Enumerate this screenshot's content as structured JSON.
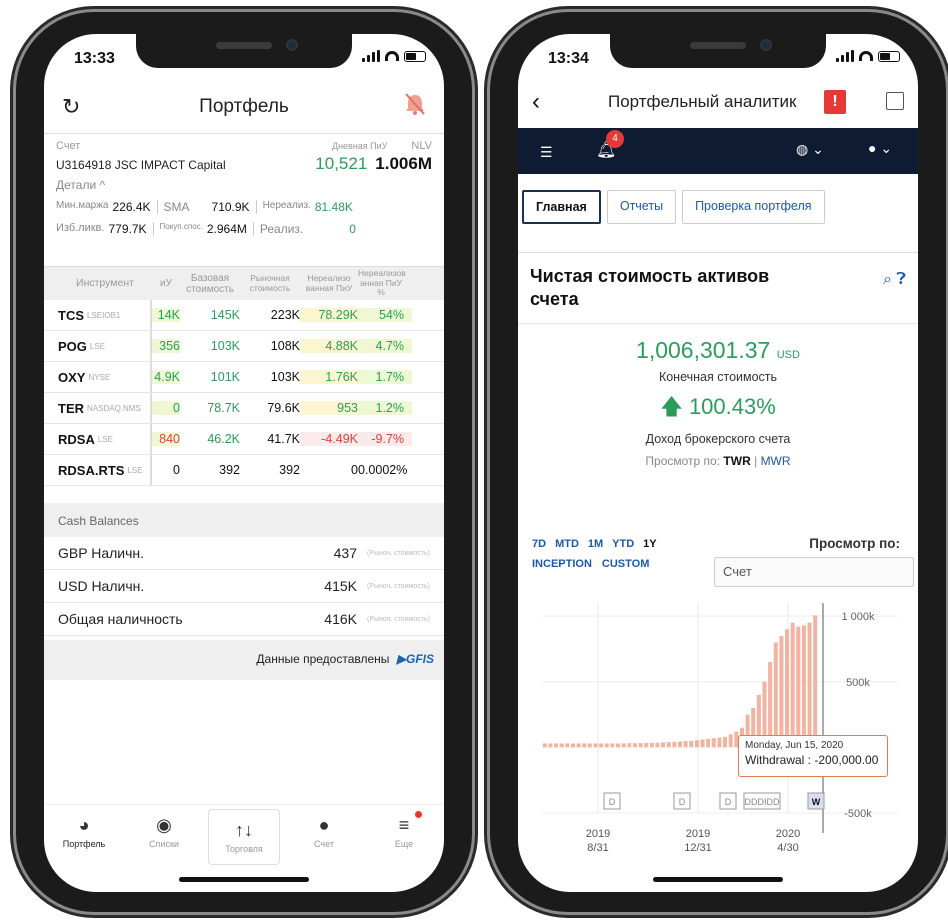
{
  "left": {
    "status_time": "13:33",
    "title": "Портфель",
    "account": {
      "label": "Счет",
      "daily_pnl_label": "Дневная ПиУ",
      "nlv_label": "NLV",
      "name": "U3164918 JSC IMPACT Capital",
      "daily_pnl": "10,521",
      "nlv": "1.006M",
      "details": "Детали ^"
    },
    "metrics": [
      {
        "l1": "Мин.маржа",
        "v1": "226.4K",
        "l2": "SMA",
        "v2": "710.9K",
        "l3": "Нереализ.",
        "v3": "81.48K"
      },
      {
        "l1": "Изб.ликв.",
        "v1": "779.7K",
        "l2": "Покуп.спос.",
        "v2": "2.964M",
        "l3": "Реализ.",
        "v3": "0"
      }
    ],
    "table_headers": [
      "Инструмент",
      "иУ",
      "Базовая стоимость",
      "Рыночная стоимость",
      "Нереализо ванная ПиУ",
      "Нереализов анная ПиУ %"
    ],
    "rows": [
      {
        "sym": "TCS",
        "ex": "LSEIOB1",
        "c1": "14K",
        "c2": "145K",
        "c3": "223K",
        "c4": "78.29K",
        "c5": "54%",
        "tone": "pos"
      },
      {
        "sym": "POG",
        "ex": "LSE",
        "c1": "356",
        "c2": "103K",
        "c3": "108K",
        "c4": "4.88K",
        "c5": "4.7%",
        "tone": "pos"
      },
      {
        "sym": "OXY",
        "ex": "NYSE",
        "c1": "4.9K",
        "c2": "101K",
        "c3": "103K",
        "c4": "1.76K",
        "c5": "1.7%",
        "tone": "pos"
      },
      {
        "sym": "TER",
        "ex": "NASDAQ.NMS",
        "c1": "0",
        "c2": "78.7K",
        "c3": "79.6K",
        "c4": "953",
        "c5": "1.2%",
        "tone": "pos"
      },
      {
        "sym": "RDSA",
        "ex": "LSE",
        "c1": "840",
        "c2": "46.2K",
        "c3": "41.7K",
        "c4": "-4.49K",
        "c5": "-9.7%",
        "tone": "neg"
      },
      {
        "sym": "RDSA.RTS",
        "ex": "LSE",
        "c1": "0",
        "c2": "392",
        "c3": "392",
        "c4": "0",
        "c5": "0.0002%",
        "tone": "neu"
      }
    ],
    "cash_header": "Cash Balances",
    "cash": [
      {
        "name": "GBP Наличн.",
        "value": "437",
        "note": "(Рыноч. стоимость)"
      },
      {
        "name": "USD Наличн.",
        "value": "415K",
        "note": "(Рыноч. стоимость)"
      },
      {
        "name": "Общая наличность",
        "value": "416K",
        "note": "(Рыноч. стоимость)"
      }
    ],
    "provided_by": "Данные предоставлены",
    "provider": "GFIS",
    "tabs": [
      "Портфель",
      "Списки",
      "Торговля",
      "Счет",
      "Еще"
    ]
  },
  "right": {
    "status_time": "13:34",
    "title": "Портфельный аналитик",
    "alert_mark": "!",
    "notif_count": "4",
    "tabs": [
      "Главная",
      "Отчеты",
      "Проверка портфеля"
    ],
    "card_title": "Чистая стоимость активов счета",
    "value": "1,006,301.37",
    "currency": "USD",
    "value_label": "Конечная стоимость",
    "return_pct": "100.43%",
    "return_label": "Доход брокерского счета",
    "view_by_prefix": "Просмотр по:",
    "view_twr": "TWR",
    "view_sep": "|",
    "view_mwr": "MWR",
    "ranges": [
      "7D",
      "MTD",
      "1M",
      "YTD",
      "1Y"
    ],
    "ranges2": [
      "INCEPTION",
      "CUSTOM"
    ],
    "view_by_title": "Просмотр по:",
    "select_value": "Счет",
    "tooltip_date": "Monday, Jun 15, 2020",
    "tooltip_text": "Withdrawal : -200,000.00"
  },
  "chart_data": {
    "type": "bar",
    "x_tick_labels": [
      [
        "2019",
        "8/31"
      ],
      [
        "2019",
        "12/31"
      ],
      [
        "2020",
        "4/30"
      ]
    ],
    "y_tick_labels": [
      "1 000k",
      "500k",
      "-500k"
    ],
    "ylim": [
      -500000,
      1100000
    ],
    "values": [
      30000,
      30000,
      30000,
      30000,
      30000,
      30000,
      30000,
      30000,
      30000,
      30000,
      30000,
      30000,
      30000,
      30000,
      30000,
      32000,
      32000,
      32000,
      33000,
      34000,
      35000,
      38000,
      40000,
      42000,
      45000,
      48000,
      50000,
      55000,
      60000,
      65000,
      70000,
      75000,
      80000,
      100000,
      120000,
      150000,
      250000,
      300000,
      400000,
      500000,
      650000,
      800000,
      850000,
      900000,
      950000,
      920000,
      930000,
      950000,
      1006000
    ],
    "markers": [
      "D",
      "D",
      "D",
      "DDDIDD",
      "W"
    ]
  }
}
